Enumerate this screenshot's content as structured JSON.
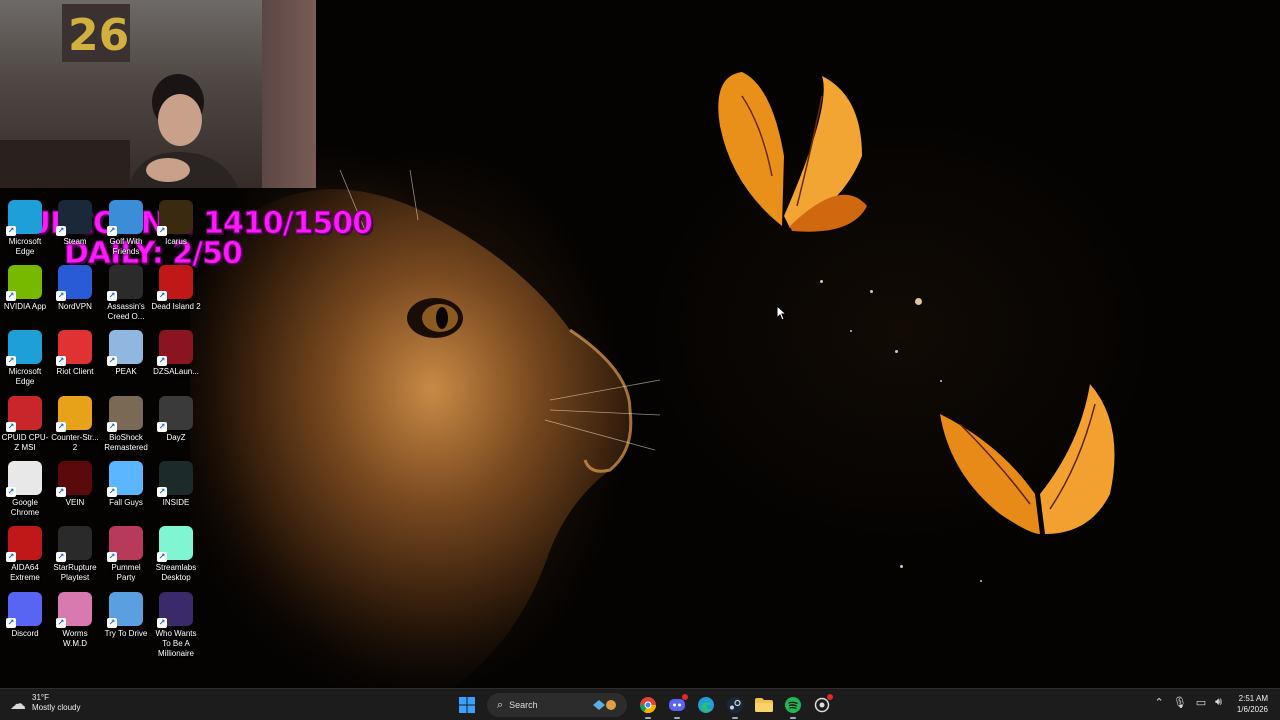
{
  "overlay": {
    "subcount": "SUBCOUNT: 1410/1500",
    "daily": "DAILY: 2/50"
  },
  "desktop_icons": [
    {
      "label": "Microsoft Edge",
      "icon": "edge-icon",
      "color": "#1f9fd8"
    },
    {
      "label": "Steam",
      "icon": "steam-icon",
      "color": "#1b2838"
    },
    {
      "label": "Golf With Friends",
      "icon": "golf-icon",
      "color": "#3a8dd6"
    },
    {
      "label": "Icarus",
      "icon": "icarus-icon",
      "color": "#3a2a10"
    },
    {
      "label": "NVIDIA App",
      "icon": "nvidia-icon",
      "color": "#76b900"
    },
    {
      "label": "NordVPN",
      "icon": "nordvpn-icon",
      "color": "#2a5bd7"
    },
    {
      "label": "Assassin's Creed O...",
      "icon": "assassins-creed-icon",
      "color": "#2b2b2b"
    },
    {
      "label": "Dead Island 2",
      "icon": "dead-island-icon",
      "color": "#c01818"
    },
    {
      "label": "Microsoft Edge",
      "icon": "edge-icon",
      "color": "#1f9fd8"
    },
    {
      "label": "Riot Client",
      "icon": "riot-icon",
      "color": "#e03232"
    },
    {
      "label": "PEAK",
      "icon": "peak-icon",
      "color": "#8fb7e0"
    },
    {
      "label": "DZSALaun...",
      "icon": "dzsa-icon",
      "color": "#8a1420"
    },
    {
      "label": "CPUID CPU-Z MSI",
      "icon": "cpuz-icon",
      "color": "#c8262a"
    },
    {
      "label": "Counter-Str... 2",
      "icon": "counter-strike-icon",
      "color": "#e8a21a"
    },
    {
      "label": "BioShock Remastered",
      "icon": "bioshock-icon",
      "color": "#7a6a55"
    },
    {
      "label": "DayZ",
      "icon": "dayz-icon",
      "color": "#3a3a3a"
    },
    {
      "label": "Google Chrome",
      "icon": "chrome-icon",
      "color": "#e8e8e8"
    },
    {
      "label": "VEIN",
      "icon": "vein-icon",
      "color": "#5a0a0a"
    },
    {
      "label": "Fall Guys",
      "icon": "fall-guys-icon",
      "color": "#5bb6ff"
    },
    {
      "label": "INSIDE",
      "icon": "inside-icon",
      "color": "#1d2a2a"
    },
    {
      "label": "AIDA64 Extreme",
      "icon": "aida64-icon",
      "color": "#c01818"
    },
    {
      "label": "StarRupture Playtest",
      "icon": "starrupture-icon",
      "color": "#2a2a2a"
    },
    {
      "label": "Pummel Party",
      "icon": "pummel-party-icon",
      "color": "#b83a5a"
    },
    {
      "label": "Streamlabs Desktop",
      "icon": "streamlabs-icon",
      "color": "#80f5d2"
    },
    {
      "label": "Discord",
      "icon": "discord-icon",
      "color": "#5865f2"
    },
    {
      "label": "Worms W.M.D",
      "icon": "worms-icon",
      "color": "#d87ab0"
    },
    {
      "label": "Try To Drive",
      "icon": "try-to-drive-icon",
      "color": "#5aa0e0"
    },
    {
      "label": "Who Wants To Be A Millionaire",
      "icon": "millionaire-icon",
      "color": "#3a2a6a"
    }
  ],
  "taskbar": {
    "weather_temp": "31°F",
    "weather_desc": "Mostly cloudy",
    "search_label": "Search",
    "time": "2:51 AM",
    "date": "1/6/2026",
    "apps": [
      {
        "name": "windows-start",
        "icon": "windows-icon"
      },
      {
        "name": "chrome",
        "icon": "chrome-icon"
      },
      {
        "name": "discord",
        "icon": "discord-icon"
      },
      {
        "name": "edge",
        "icon": "edge-icon"
      },
      {
        "name": "steam",
        "icon": "steam-icon"
      },
      {
        "name": "file-explorer",
        "icon": "folder-icon"
      },
      {
        "name": "spotify",
        "icon": "spotify-icon"
      },
      {
        "name": "record",
        "icon": "record-icon"
      }
    ],
    "tray": [
      "chevron-up-icon",
      "microphone-icon",
      "network-icon",
      "volume-icon"
    ]
  }
}
